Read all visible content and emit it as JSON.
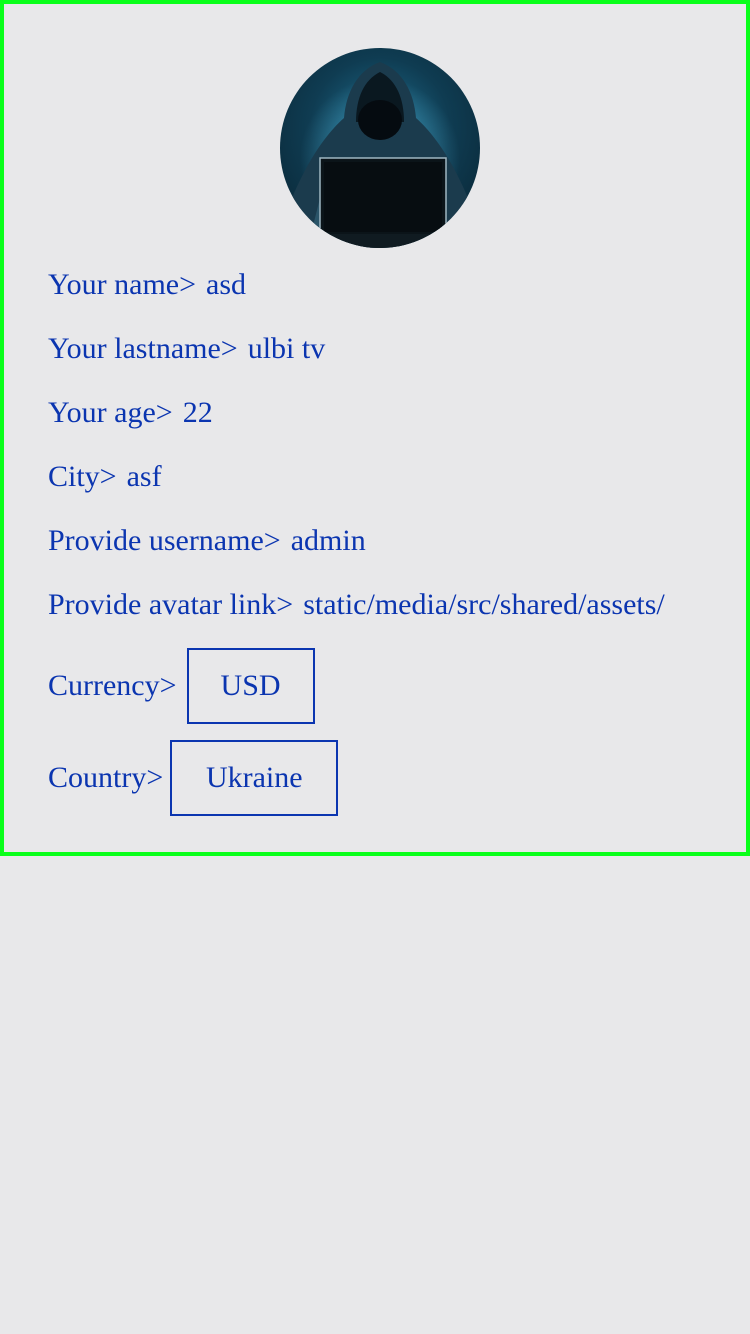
{
  "profile": {
    "name_label": "Your name>",
    "name_value": "asd",
    "lastname_label": "Your lastname>",
    "lastname_value": "ulbi tv",
    "age_label": "Your age>",
    "age_value": "22",
    "city_label": "City>",
    "city_value": "asf",
    "username_label": "Provide username>",
    "username_value": "admin",
    "avatar_label": "Provide avatar link>",
    "avatar_value": "static/media/src/shared/assets/",
    "currency_label": "Currency>",
    "currency_value": "USD",
    "country_label": "Country>",
    "country_value": "Ukraine"
  },
  "colors": {
    "text": "#0b35b0",
    "border": "#0aff1a",
    "background": "#e8e8ea"
  }
}
